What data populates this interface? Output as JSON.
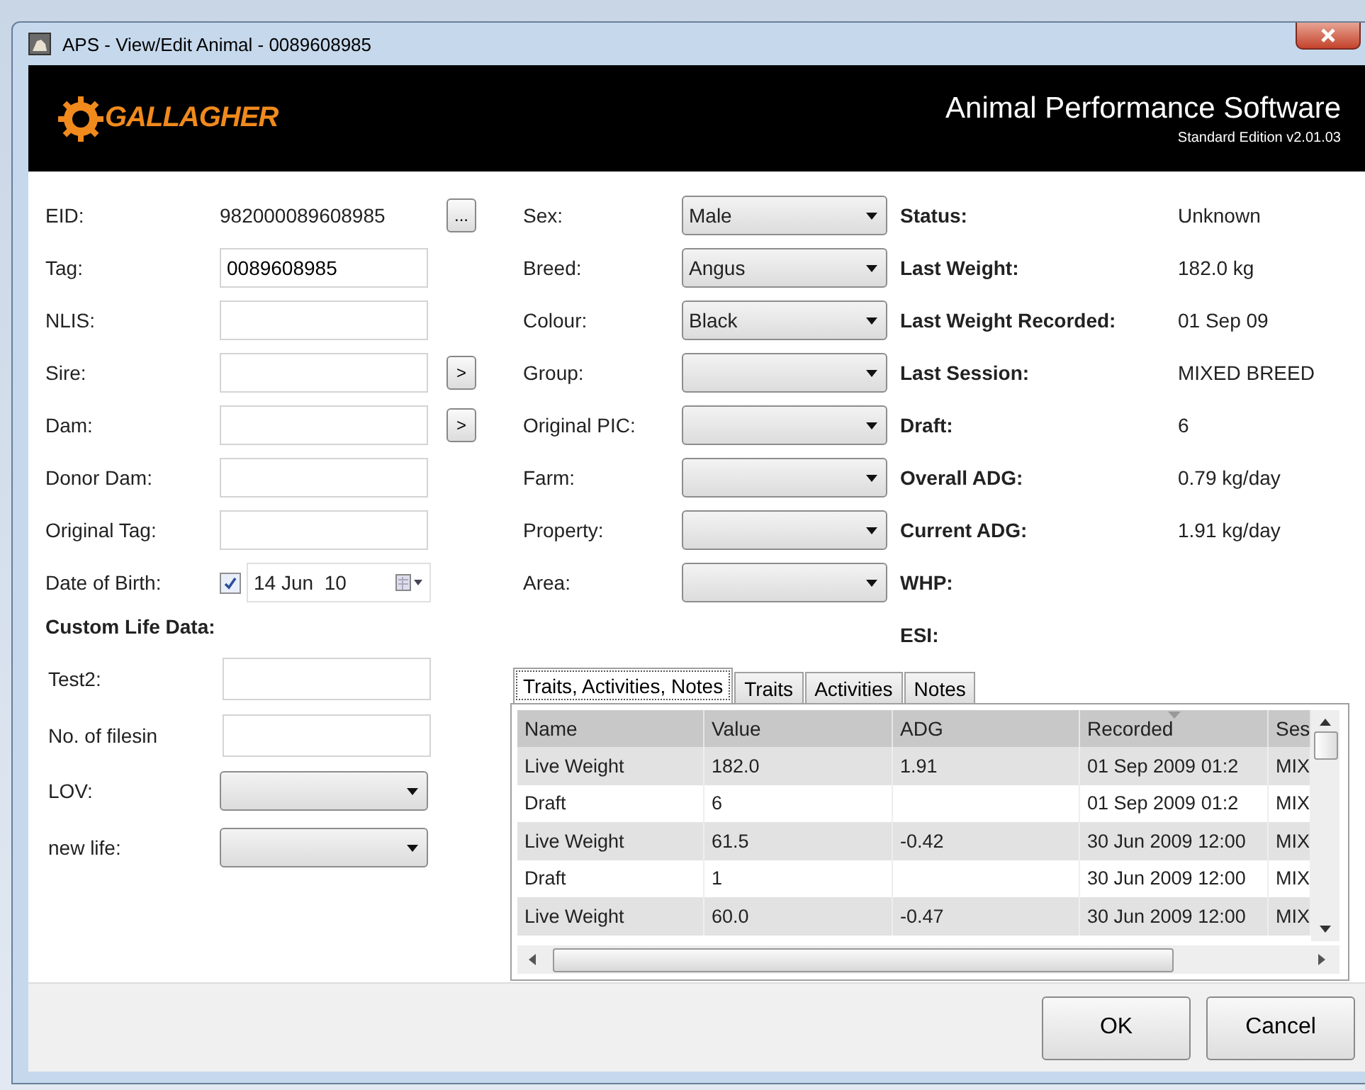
{
  "window": {
    "title": "APS - View/Edit Animal - 0089608985"
  },
  "header": {
    "logo_text": "GALLAGHER",
    "title": "Animal Performance Software",
    "subtitle": "Standard Edition v2.01.03"
  },
  "left_fields": [
    {
      "kind": "static",
      "label": "EID:",
      "value": "982000089608985",
      "button": "..."
    },
    {
      "kind": "text",
      "label": "Tag:",
      "value": "0089608985"
    },
    {
      "kind": "text",
      "label": "NLIS:"
    },
    {
      "kind": "text",
      "label": "Sire:",
      "button": ">"
    },
    {
      "kind": "text",
      "label": "Dam:",
      "button": ">"
    },
    {
      "kind": "text",
      "label": "Donor Dam:"
    },
    {
      "kind": "text",
      "label": "Original Tag:"
    },
    {
      "kind": "date",
      "label": "Date of Birth:",
      "value": "14 Jun  10",
      "checked": true
    }
  ],
  "custom_life": {
    "heading": "Custom Life Data:",
    "fields": [
      {
        "kind": "text",
        "label": "Test2:"
      },
      {
        "kind": "text",
        "label": "No. of filesin"
      },
      {
        "kind": "dropdown",
        "label": "LOV:"
      },
      {
        "kind": "dropdown",
        "label": "new life:"
      }
    ]
  },
  "dropdowns": [
    {
      "label": "Sex:",
      "value": "Male"
    },
    {
      "label": "Breed:",
      "value": "Angus"
    },
    {
      "label": "Colour:",
      "value": "Black"
    },
    {
      "label": "Group:"
    },
    {
      "label": "Original PIC:"
    },
    {
      "label": "Farm:"
    },
    {
      "label": "Property:"
    },
    {
      "label": "Area:"
    }
  ],
  "stats": [
    {
      "label": "Status:",
      "value": "Unknown"
    },
    {
      "label": "Last Weight:",
      "value": "182.0 kg"
    },
    {
      "label": "Last Weight Recorded:",
      "value": "01 Sep 09"
    },
    {
      "label": "Last Session:",
      "value": "MIXED BREED"
    },
    {
      "label": "Draft:",
      "value": "6"
    },
    {
      "label": "Overall ADG:",
      "value": "0.79 kg/day"
    },
    {
      "label": "Current ADG:",
      "value": "1.91 kg/day"
    },
    {
      "label": "WHP:"
    },
    {
      "label": "ESI:"
    }
  ],
  "tabs": [
    {
      "label": "Traits, Activities, Notes",
      "selected": true
    },
    {
      "label": "Traits",
      "selected": false
    },
    {
      "label": "Activities",
      "selected": false
    },
    {
      "label": "Notes",
      "selected": false
    }
  ],
  "table": {
    "columns": [
      {
        "label": "Name",
        "sorted": false
      },
      {
        "label": "Value",
        "sorted": false
      },
      {
        "label": "ADG",
        "sorted": false
      },
      {
        "label": "Recorded",
        "sorted": true
      },
      {
        "label": "Ses",
        "sorted": false
      }
    ],
    "rows": [
      [
        "Live Weight",
        "182.0",
        "1.91",
        "01 Sep 2009 01:2",
        "MIX"
      ],
      [
        "Draft",
        "6",
        "",
        "01 Sep 2009 01:2",
        "MIX"
      ],
      [
        "Live Weight",
        "61.5",
        "-0.42",
        "30 Jun 2009 12:00",
        "MIX"
      ],
      [
        "Draft",
        "1",
        "",
        "30 Jun 2009 12:00",
        "MIX"
      ],
      [
        "Live Weight",
        "60.0",
        "-0.47",
        "30 Jun 2009 12:00",
        "MIX"
      ]
    ]
  },
  "buttons": [
    "OK",
    "Cancel"
  ]
}
